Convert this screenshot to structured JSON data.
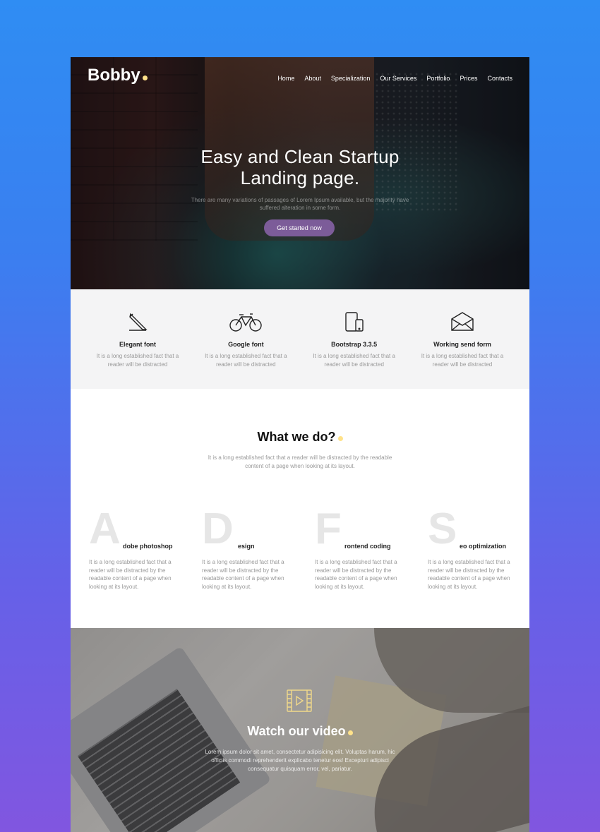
{
  "header": {
    "logo": "Bobby",
    "nav": [
      "Home",
      "About",
      "Specialization",
      "Our Services",
      "Portfolio",
      "Prices",
      "Contacts"
    ]
  },
  "hero": {
    "title_line1": "Easy and Clean Startup",
    "title_line2": "Landing page.",
    "subtitle": "There are many variations of passages of Lorem Ipsum available, but the majority have suffered alteration in some form.",
    "cta": "Get started now"
  },
  "features": [
    {
      "icon": "pencil-icon",
      "title": "Elegant font",
      "text": "It is a long established fact that a reader will be distracted"
    },
    {
      "icon": "bicycle-icon",
      "title": "Google font",
      "text": "It is a long established fact that a reader will be distracted"
    },
    {
      "icon": "devices-icon",
      "title": "Bootstrap 3.3.5",
      "text": "It is a long established fact that a reader will be distracted"
    },
    {
      "icon": "envelope-icon",
      "title": "Working send form",
      "text": "It is a long established fact that a reader will be distracted"
    }
  ],
  "what_we_do": {
    "title": "What we do?",
    "intro": "It is a long established fact that a reader will be distracted by the readable content of a page when looking at its layout.",
    "services": [
      {
        "letter": "A",
        "rest": "dobe photoshop",
        "text": "It is a long established fact that a reader will be distracted by the readable content of a page when looking at its layout."
      },
      {
        "letter": "D",
        "rest": "esign",
        "text": "It is a long established fact that a reader will be distracted by the readable content of a page when looking at its layout."
      },
      {
        "letter": "F",
        "rest": "rontend coding",
        "text": "It is a long established fact that a reader will be distracted by the readable content of a page when looking at its layout."
      },
      {
        "letter": "S",
        "rest": "eo optimization",
        "text": "It is a long established fact that a reader will be distracted by the readable content of a page when looking at its layout."
      }
    ]
  },
  "video": {
    "icon": "film-play-icon",
    "title": "Watch our video",
    "text": "Lorem ipsum dolor sit amet, consectetur adipisicing elit. Voluptas harum, hic officiis commodi reprehenderit explicabo tenetur eos! Excepturi adipisci consequatur quisquam error, vel, pariatur."
  },
  "colors": {
    "accent_dot": "#ffe28a",
    "button": "#7c5c99",
    "background_top": "#2f8df3",
    "background_bottom": "#8156e0"
  }
}
